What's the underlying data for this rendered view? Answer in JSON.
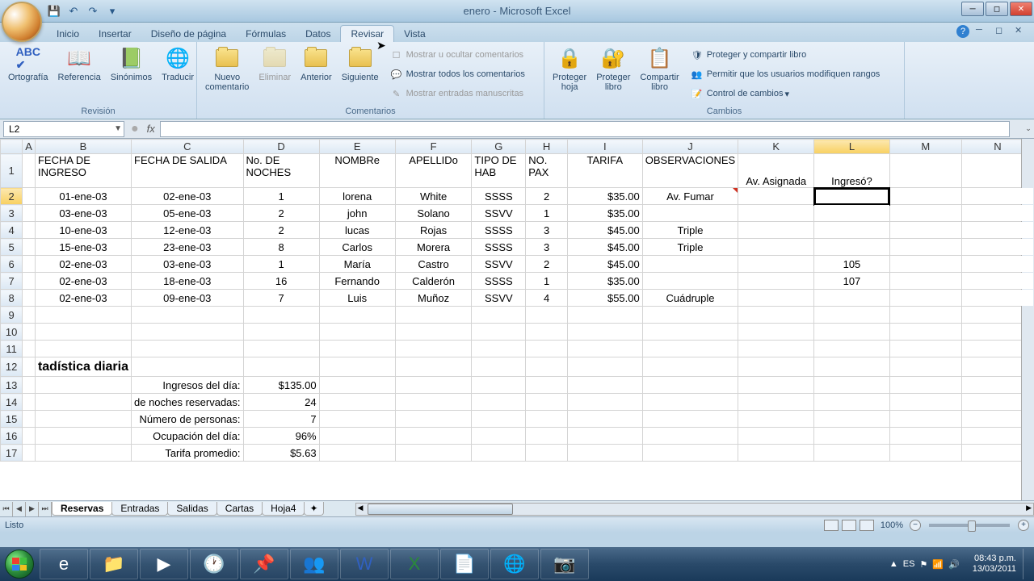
{
  "window": {
    "title": "enero - Microsoft Excel"
  },
  "qat": {
    "save": "💾",
    "undo": "↶",
    "redo": "↷"
  },
  "tabs": {
    "inicio": "Inicio",
    "insertar": "Insertar",
    "diseno": "Diseño de página",
    "formulas": "Fórmulas",
    "datos": "Datos",
    "revisar": "Revisar",
    "vista": "Vista"
  },
  "ribbon": {
    "revision": {
      "label": "Revisión",
      "ortografia": "Ortografía",
      "referencia": "Referencia",
      "sinonimos": "Sinónimos",
      "traducir": "Traducir"
    },
    "comentarios": {
      "label": "Comentarios",
      "nuevo": "Nuevo\ncomentario",
      "eliminar": "Eliminar",
      "anterior": "Anterior",
      "siguiente": "Siguiente",
      "mostrar_ocultar": "Mostrar u ocultar comentarios",
      "mostrar_todos": "Mostrar todos los comentarios",
      "mostrar_entradas": "Mostrar entradas manuscritas"
    },
    "cambios": {
      "label": "Cambios",
      "proteger_hoja": "Proteger\nhoja",
      "proteger_libro": "Proteger\nlibro",
      "compartir_libro": "Compartir\nlibro",
      "proteger_compartir": "Proteger y compartir libro",
      "permitir_rangos": "Permitir que los usuarios modifiquen rangos",
      "control_cambios": "Control de cambios"
    }
  },
  "namebox": "L2",
  "columns": [
    "A",
    "B",
    "C",
    "D",
    "E",
    "F",
    "G",
    "H",
    "I",
    "J",
    "K",
    "L",
    "M",
    "N"
  ],
  "headers": {
    "B": "FECHA DE INGRESO",
    "C": "FECHA DE SALIDA",
    "D": "No. DE NOCHES",
    "E": "NOMBRe",
    "F": "APELLIDo",
    "G": "TIPO DE HAB",
    "H": "NO. PAX",
    "I": "TARIFA",
    "J": "OBSERVACIONES",
    "K": "Av. Asignada",
    "L": "Ingresó?"
  },
  "rows": [
    {
      "r": 2,
      "B": "01-ene-03",
      "C": "02-ene-03",
      "D": "1",
      "E": "lorena",
      "F": "White",
      "G": "SSSS",
      "H": "2",
      "I": "$35.00",
      "J": "Av. Fumar",
      "K": "",
      "L": ""
    },
    {
      "r": 3,
      "B": "03-ene-03",
      "C": "05-ene-03",
      "D": "2",
      "E": "john",
      "F": "Solano",
      "G": "SSVV",
      "H": "1",
      "I": "$35.00",
      "J": "",
      "K": "",
      "L": ""
    },
    {
      "r": 4,
      "B": "10-ene-03",
      "C": "12-ene-03",
      "D": "2",
      "E": "lucas",
      "F": "Rojas",
      "G": "SSSS",
      "H": "3",
      "I": "$45.00",
      "J": "Triple",
      "K": "",
      "L": ""
    },
    {
      "r": 5,
      "B": "15-ene-03",
      "C": "23-ene-03",
      "D": "8",
      "E": "Carlos",
      "F": "Morera",
      "G": "SSSS",
      "H": "3",
      "I": "$45.00",
      "J": "Triple",
      "K": "",
      "L": ""
    },
    {
      "r": 6,
      "B": "02-ene-03",
      "C": "03-ene-03",
      "D": "1",
      "E": "María",
      "F": "Castro",
      "G": "SSVV",
      "H": "2",
      "I": "$45.00",
      "J": "",
      "K": "",
      "L": "105"
    },
    {
      "r": 7,
      "B": "02-ene-03",
      "C": "18-ene-03",
      "D": "16",
      "E": "Fernando",
      "F": "Calderón",
      "G": "SSSS",
      "H": "1",
      "I": "$35.00",
      "J": "",
      "K": "",
      "L": "107"
    },
    {
      "r": 8,
      "B": "02-ene-03",
      "C": "09-ene-03",
      "D": "7",
      "E": "Luis",
      "F": "Muñoz",
      "G": "SSVV",
      "H": "4",
      "I": "$55.00",
      "J": "Cuádruple",
      "K": "",
      "L": ""
    }
  ],
  "stats": {
    "title": "tadística diaria",
    "rows": [
      {
        "label": "Ingresos del día:",
        "value": "$135.00"
      },
      {
        "label": "de noches reservadas:",
        "value": "24"
      },
      {
        "label": "Número de personas:",
        "value": "7"
      },
      {
        "label": "Ocupación del día:",
        "value": "96%"
      },
      {
        "label": "Tarifa promedio:",
        "value": "$5.63"
      }
    ]
  },
  "sheets": {
    "reservas": "Reservas",
    "entradas": "Entradas",
    "salidas": "Salidas",
    "cartas": "Cartas",
    "hoja4": "Hoja4"
  },
  "status": {
    "ready": "Listo",
    "zoom": "100%"
  },
  "tray": {
    "lang": "ES",
    "time": "08:43 p.m.",
    "date": "13/03/2011"
  }
}
